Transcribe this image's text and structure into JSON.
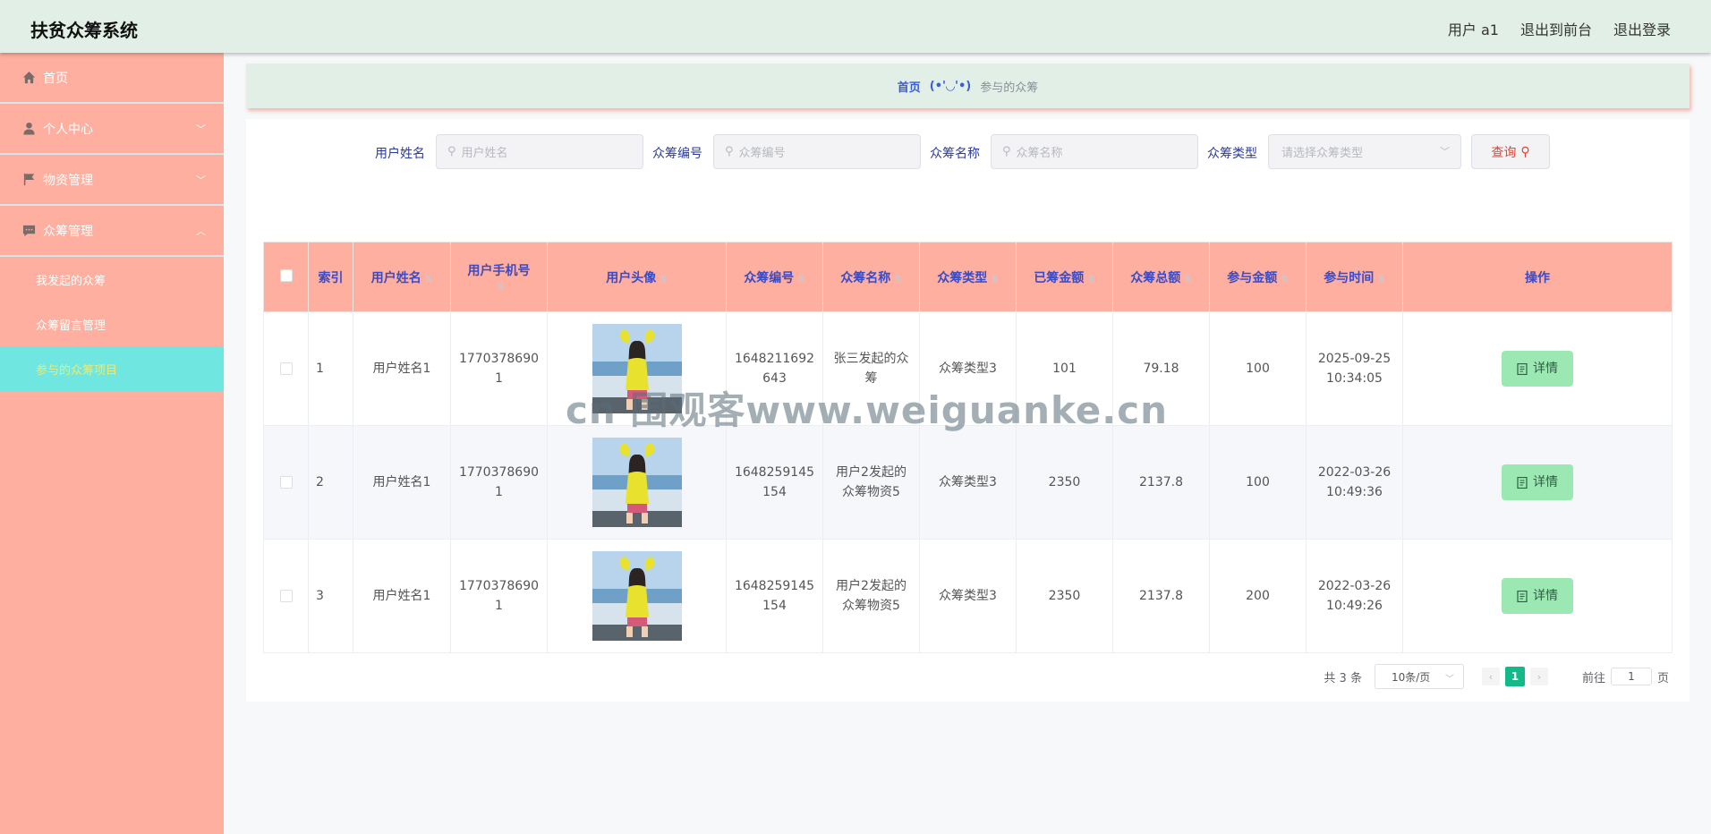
{
  "header": {
    "title": "扶贫众筹系统",
    "user": "用户 a1",
    "to_front": "退出到前台",
    "logout": "退出登录"
  },
  "sidebar": {
    "items": [
      {
        "label": "首页",
        "icon": "home-icon"
      },
      {
        "label": "个人中心",
        "icon": "user-icon",
        "arrow": "﹀"
      },
      {
        "label": "物资管理",
        "icon": "flag-icon",
        "arrow": "﹀"
      },
      {
        "label": "众筹管理",
        "icon": "chat-icon",
        "arrow": "︿"
      }
    ],
    "sub_items": [
      "我发起的众筹",
      "众筹留言管理",
      "参与的众筹项目"
    ]
  },
  "breadcrumb": {
    "home": "首页",
    "face": "(•'◡'•)",
    "current": "参与的众筹"
  },
  "search": {
    "username_label": "用户姓名",
    "username_placeholder": "用户姓名",
    "code_label": "众筹编号",
    "code_placeholder": "众筹编号",
    "name_label": "众筹名称",
    "name_placeholder": "众筹名称",
    "type_label": "众筹类型",
    "type_placeholder": "请选择众筹类型",
    "query_label": "查询"
  },
  "table": {
    "headers": [
      "索引",
      "用户姓名",
      "用户手机号",
      "用户头像",
      "众筹编号",
      "众筹名称",
      "众筹类型",
      "已筹金额",
      "众筹总额",
      "参与金额",
      "参与时间",
      "操作"
    ],
    "rows": [
      {
        "index": "1",
        "name": "用户姓名1",
        "phone_a": "1770378690",
        "phone_b": "1",
        "code_a": "1648211692",
        "code_b": "643",
        "title_a": "张三发起的众",
        "title_b": "筹",
        "type": "众筹类型3",
        "raised": "101",
        "total": "79.18",
        "amount": "100",
        "date": "2025-09-25",
        "time": "10:34:05",
        "action": "详情"
      },
      {
        "index": "2",
        "name": "用户姓名1",
        "phone_a": "1770378690",
        "phone_b": "1",
        "code_a": "1648259145",
        "code_b": "154",
        "title_a": "用户2发起的",
        "title_b": "众筹物资5",
        "type": "众筹类型3",
        "raised": "2350",
        "total": "2137.8",
        "amount": "100",
        "date": "2022-03-26",
        "time": "10:49:36",
        "action": "详情"
      },
      {
        "index": "3",
        "name": "用户姓名1",
        "phone_a": "1770378690",
        "phone_b": "1",
        "code_a": "1648259145",
        "code_b": "154",
        "title_a": "用户2发起的",
        "title_b": "众筹物资5",
        "type": "众筹类型3",
        "raised": "2350",
        "total": "2137.8",
        "amount": "200",
        "date": "2022-03-26",
        "time": "10:49:26",
        "action": "详情"
      }
    ]
  },
  "pagination": {
    "total": "共 3 条",
    "page_size": "10条/页",
    "current": "1",
    "goto_label": "前往",
    "goto_value": "1",
    "page_unit": "页"
  },
  "watermark": "cn 围观客www.weiguanke.cn",
  "colors": {
    "header_bg": "#e1efe7",
    "sidebar_bg": "#ffaf9f",
    "active_bg": "#6fe7e0",
    "table_head_bg": "#ffafa0",
    "accent_text": "#3a4bc7",
    "detail_btn": "#9be8b2",
    "page_active": "#14b98a"
  }
}
